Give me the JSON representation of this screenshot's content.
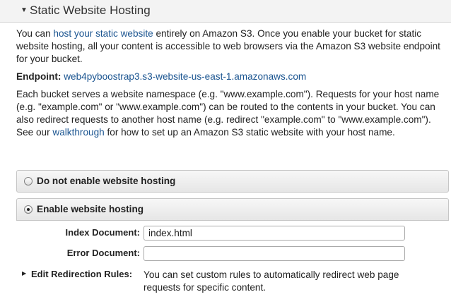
{
  "header": {
    "title": "Static Website Hosting",
    "expand_icon": "triangle-down-icon"
  },
  "intro": {
    "text_before": "You can ",
    "link_text": "host your static website",
    "text_after": " entirely on Amazon S3. Once you enable your bucket for static website hosting, all your content is accessible to web browsers via the Amazon S3 website endpoint for your bucket."
  },
  "endpoint": {
    "label": "Endpoint:",
    "value": "web4pyboostrap3.s3-website-us-east-1.amazonaws.com"
  },
  "namespace": {
    "text_before": "Each bucket serves a website namespace (e.g. \"www.example.com\"). Requests for your host name (e.g. \"example.com\" or \"www.example.com\") can be routed to the contents in your bucket. You can also redirect requests to another host name (e.g. redirect \"example.com\" to \"www.example.com\"). See our ",
    "link_text": "walkthrough",
    "text_after": " for how to set up an Amazon S3 static website with your host name."
  },
  "options": {
    "disable_label": "Do not enable website hosting",
    "enable_label": "Enable website hosting",
    "selected": "enable"
  },
  "form": {
    "index_label": "Index Document:",
    "index_value": "index.html",
    "error_label": "Error Document:",
    "error_value": ""
  },
  "redirection": {
    "label": "Edit Redirection Rules:",
    "description": "You can set custom rules to automatically redirect web page requests for specific content.",
    "expand_icon": "triangle-right-icon"
  }
}
